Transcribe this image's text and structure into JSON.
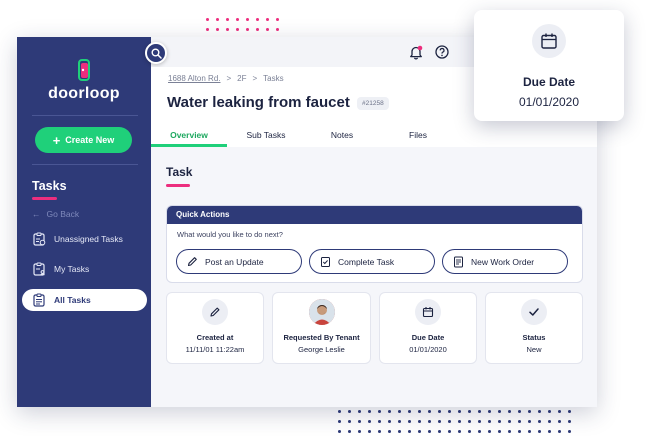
{
  "colors": {
    "sidebar": "#2e3a78",
    "accent_green": "#1fd07a",
    "accent_pink": "#ec2e7e"
  },
  "brand": {
    "name": "doorloop"
  },
  "sidebar": {
    "create_button": "Create New",
    "section_title": "Tasks",
    "go_back": "Go Back",
    "items": [
      {
        "label": "Unassigned Tasks",
        "icon": "clipboard-question-icon",
        "active": false
      },
      {
        "label": "My Tasks",
        "icon": "clipboard-user-icon",
        "active": false
      },
      {
        "label": "All Tasks",
        "icon": "clipboard-list-icon",
        "active": true
      }
    ]
  },
  "header": {
    "breadcrumb": [
      "1688 Alton Rd.",
      "2F",
      "Tasks"
    ],
    "title": "Water leaking from faucet",
    "task_id": "#21258",
    "tabs": [
      "Overview",
      "Sub Tasks",
      "Notes",
      "Files"
    ],
    "active_tab": "Overview"
  },
  "main": {
    "section_title": "Task",
    "quick_actions": {
      "title": "Quick Actions",
      "prompt": "What would you like to do next?",
      "buttons": [
        "Post an Update",
        "Complete Task",
        "New Work Order"
      ]
    },
    "cards": [
      {
        "label": "Created at",
        "value": "11/11/01  11:22am",
        "icon": "pencil-icon"
      },
      {
        "label": "Requested By Tenant",
        "value": "George Leslie",
        "icon": "avatar"
      },
      {
        "label": "Due Date",
        "value": "01/01/2020",
        "icon": "calendar-icon"
      },
      {
        "label": "Status",
        "value": "New",
        "icon": "checkmark-icon"
      }
    ]
  },
  "popup": {
    "label": "Due Date",
    "value": "01/01/2020",
    "icon": "calendar-icon"
  }
}
